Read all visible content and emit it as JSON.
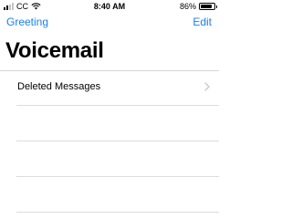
{
  "status_bar": {
    "carrier": "CC",
    "time": "8:40 AM",
    "battery_percent": "86%",
    "battery_level": 0.86,
    "icons": [
      "signal-icon",
      "wifi-icon",
      "battery-icon"
    ]
  },
  "nav": {
    "left_label": "Greeting",
    "right_label": "Edit"
  },
  "page": {
    "title": "Voicemail"
  },
  "list": {
    "items": [
      {
        "label": "Deleted Messages",
        "icon": "chevron-right-icon"
      }
    ]
  },
  "colors": {
    "accent": "#1a7ff0",
    "divider": "#dcdce0",
    "chevron": "#c7c7cc"
  }
}
